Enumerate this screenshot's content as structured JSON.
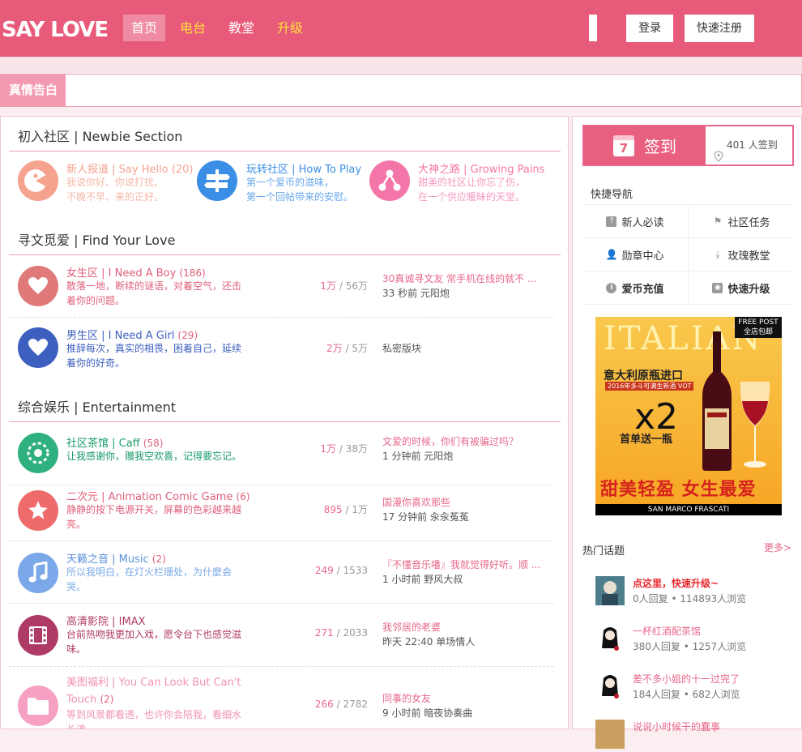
{
  "header": {
    "logo": "SAY LOVE",
    "nav": [
      {
        "label": "首页",
        "active": true,
        "color": "#ffffff"
      },
      {
        "label": "电台",
        "active": false,
        "color": "#ffe03a"
      },
      {
        "label": "教堂",
        "active": false,
        "color": "#ffffff"
      },
      {
        "label": "升级",
        "active": false,
        "color": "#ffe03a"
      }
    ],
    "login_label": "登录",
    "register_label": "快速注册"
  },
  "confession": {
    "label": "真情告白"
  },
  "sections": [
    {
      "title": "初入社区 | Newbie Section"
    },
    {
      "title": "寻文觅爱 | Find Your Love"
    },
    {
      "title": "综合娱乐 | Entertainment"
    }
  ],
  "newbie": [
    {
      "title": "新人报道 | Say Hello",
      "count": "(20)",
      "desc1": "我说你好、你说打扰、",
      "desc2": "不晚不早、来的正好。",
      "color": "#f5a38f"
    },
    {
      "title": "玩转社区 | How To Play",
      "count": "",
      "desc1": "第一个爱币的滋味，",
      "desc2": "第一个回帖带来的安慰。",
      "color": "#3a8ee6"
    },
    {
      "title": "大神之路 | Growing Pains",
      "count": "",
      "desc1": "甜美的社区让你忘了伤，",
      "desc2": "在一个供应暖昧的天堂。",
      "color": "#f476a8"
    }
  ],
  "forums": [
    {
      "title": "女生区 | I Need A Boy",
      "count": "(186)",
      "desc": "散落一地，断续的谜语，对着空气，还击着你的问题。",
      "hot": "1万",
      "total": "56万",
      "last": "30真诚寻文友 常手机在线的就不 ...",
      "lastinfo": "33 秒前 元阳炮",
      "color": "#e07a7a",
      "titlecolor": "#e0607a"
    },
    {
      "title": "男生区 | I Need A Girl",
      "count": "(29)",
      "desc": "推辞每次，真实的相畏，困着自己，延续着你的好奇。",
      "hot": "2万",
      "total": "5万",
      "last": "",
      "lastinfo": "私密版块",
      "color": "#3d5fbf",
      "titlecolor": "#3d5fbf"
    },
    {
      "title": "社区茶馆 | Caff",
      "count": "(58)",
      "desc": "让我感谢你，赠我空欢喜，记得要忘记。",
      "hot": "1万",
      "total": "38万",
      "last": "文爱的时候，你们有被骗过吗？",
      "lastinfo": "1 分钟前 元阳炮",
      "color": "#2fb07f",
      "titlecolor": "#1a9a66"
    },
    {
      "title": "二次元 | Animation Comic Game",
      "count": "(6)",
      "desc": "静静的按下电源开关，屏幕的色彩越来越亮。",
      "hot": "895",
      "total": "1万",
      "last": "国漫你喜欢那些",
      "lastinfo": "17 分钟前 汆汆菟菟",
      "color": "#ef6b6b",
      "titlecolor": "#e0607a"
    },
    {
      "title": "天籁之音 | Music",
      "count": "(2)",
      "desc": "所以我明白，在灯火栏珊处，为什麼会哭。",
      "hot": "249",
      "total": "1533",
      "last": "『不懂音乐噃』我就觉得好听。顺 ...",
      "lastinfo": "1 小时前 野风大叔",
      "color": "#7aa8e8",
      "titlecolor": "#5a8fd8"
    },
    {
      "title": "高清影院 | IMAX",
      "count": "",
      "desc": "台前热吻我更加入戏，愿令台下也感觉滋味。",
      "hot": "271",
      "total": "2033",
      "last": "我邻居的老婆",
      "lastinfo": "昨天 22:40 单场情人",
      "color": "#b03a66",
      "titlecolor": "#b03a66"
    },
    {
      "title": "美图福利 | You Can Look But Can't Touch",
      "count": "(2)",
      "desc": "等到风景都看透，也许你会陪我，看细水长流。",
      "hot": "266",
      "total": "2782",
      "last": "同事的女友",
      "lastinfo": "9 小时前 暗夜协奏曲",
      "color": "#f6a0c4",
      "titlecolor": "#f092b6"
    }
  ],
  "sidebar": {
    "sign_label": "签到",
    "sign_day": "7",
    "sign_count": "401 人签到",
    "quicknav_title": "快捷导航",
    "quicknav": [
      {
        "label": "新人必读",
        "bold": false,
        "icon": "question-icon"
      },
      {
        "label": "社区任务",
        "bold": false,
        "icon": "flag-icon"
      },
      {
        "label": "勋章中心",
        "bold": false,
        "icon": "user-icon"
      },
      {
        "label": "玫瑰教堂",
        "bold": false,
        "icon": "download-icon"
      },
      {
        "label": "爱币充值",
        "bold": true,
        "icon": "info-icon"
      },
      {
        "label": "快速升级",
        "bold": true,
        "icon": "camera-icon"
      }
    ],
    "ad": {
      "bg_text": "ITALIAN",
      "tag1": "FREE POST",
      "tag2": "全店包邮",
      "line1": "意大利原瓶进口",
      "line2": "2016年多斗可满生新酒 VOT",
      "x2": "x2",
      "line3": "首单送一瓶",
      "slogan": "甜美轻盈 女生最爱",
      "foot": "SAN MARCO FRASCATI"
    },
    "hot_title": "热门话题",
    "hot_more": "更多>",
    "topics": [
      {
        "title": "点这里，快速升级~",
        "meta": "0人回复 • 114893人浏览",
        "color": "#e8272b",
        "bold": true
      },
      {
        "title": "一杯红酒配茶馆",
        "meta": "380人回复 • 1257人浏览",
        "color": "#e8678a",
        "bold": false
      },
      {
        "title": "差不多小姐的十一过完了",
        "meta": "184人回复 • 682人浏览",
        "color": "#e8678a",
        "bold": false
      },
      {
        "title": "说说小时候干的蠢事",
        "meta": "",
        "color": "#e8678a",
        "bold": false
      }
    ]
  }
}
